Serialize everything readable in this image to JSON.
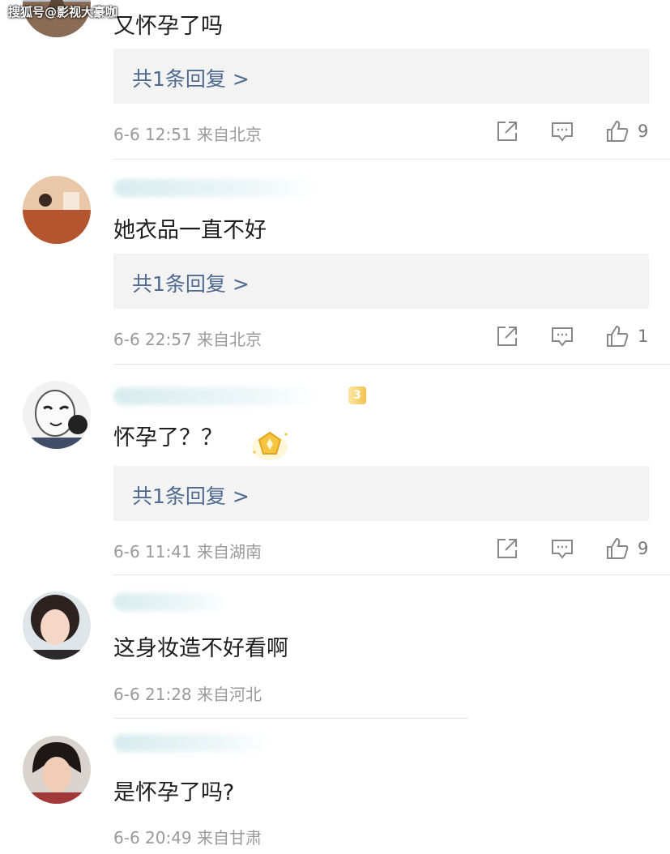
{
  "watermark": "搜狐号@影视大豪咖",
  "comments": [
    {
      "text": "又怀孕了吗",
      "reply": "共1条回复 >",
      "date": "6-6 12:51",
      "location": "来自北京",
      "likes": "9"
    },
    {
      "text": "她衣品一直不好",
      "reply": "共1条回复 >",
      "date": "6-6 22:57",
      "location": "来自北京",
      "likes": "1"
    },
    {
      "text": "怀孕了？？",
      "reply": "共1条回复 >",
      "date": "6-6 11:41",
      "location": "来自湖南",
      "likes": "9",
      "badge": "3"
    },
    {
      "text": "这身妆造不好看啊",
      "date": "6-6 21:28",
      "location": "来自河北"
    },
    {
      "text": "是怀孕了吗?",
      "date": "6-6 20:49",
      "location": "来自甘肃"
    }
  ],
  "colors": {
    "reply_link": "#4e6a8f",
    "meta": "#9a9a9a",
    "reply_bg": "#f3f3f3"
  }
}
